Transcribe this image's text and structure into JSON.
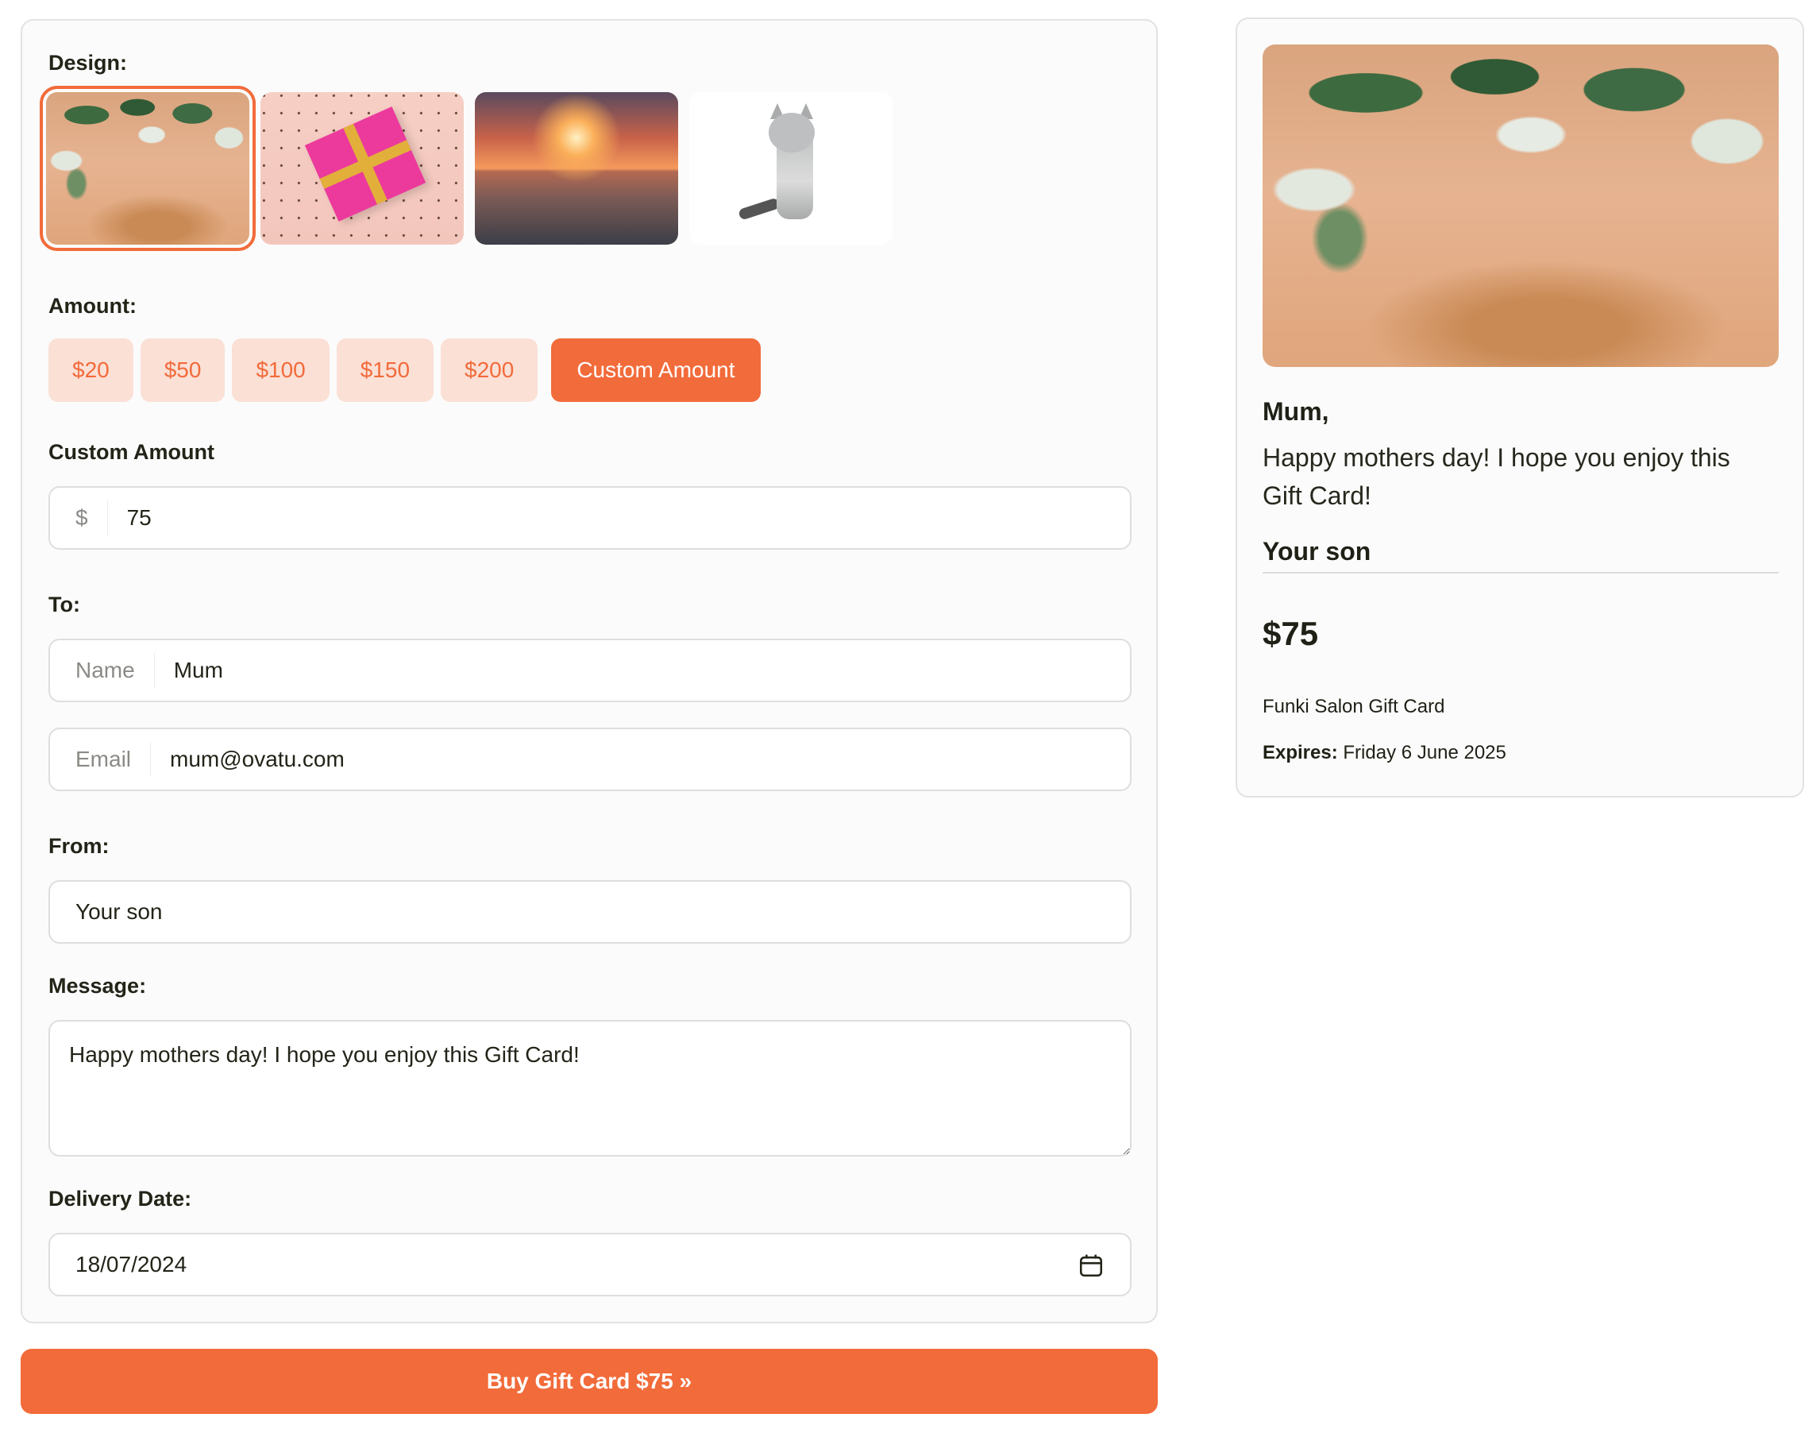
{
  "form": {
    "design_label": "Design:",
    "designs": [
      {
        "name": "Flowers on wood",
        "selected": true
      },
      {
        "name": "Pink gift box",
        "selected": false
      },
      {
        "name": "Ocean sunset",
        "selected": false
      },
      {
        "name": "Kitten",
        "selected": false
      }
    ],
    "amount_label": "Amount:",
    "amount_options": [
      "$20",
      "$50",
      "$100",
      "$150",
      "$200"
    ],
    "custom_amount_button": "Custom Amount",
    "custom_amount_label": "Custom Amount",
    "custom_amount_prefix": "$",
    "custom_amount_value": "75",
    "to_label": "To:",
    "to_name_prefix": "Name",
    "to_name_value": "Mum",
    "to_email_prefix": "Email",
    "to_email_value": "mum@ovatu.com",
    "from_label": "From:",
    "from_value": "Your son",
    "message_label": "Message:",
    "message_value": "Happy mothers day! I hope you enjoy this Gift Card!",
    "delivery_label": "Delivery Date:",
    "delivery_value": "18/07/2024",
    "calendar_icon": "calendar-icon"
  },
  "buy_button_label": "Buy Gift Card $75 »",
  "preview": {
    "to": "Mum,",
    "message": "Happy mothers day! I hope you enjoy this Gift Card!",
    "from": "Your son",
    "amount": "$75",
    "shop": "Funki Salon Gift Card",
    "expires_label": "Expires:",
    "expires_value": "Friday 6 June 2025"
  },
  "colors": {
    "accent": "#f26b3a",
    "accent_light": "#fbe0d6",
    "text": "#222418"
  }
}
